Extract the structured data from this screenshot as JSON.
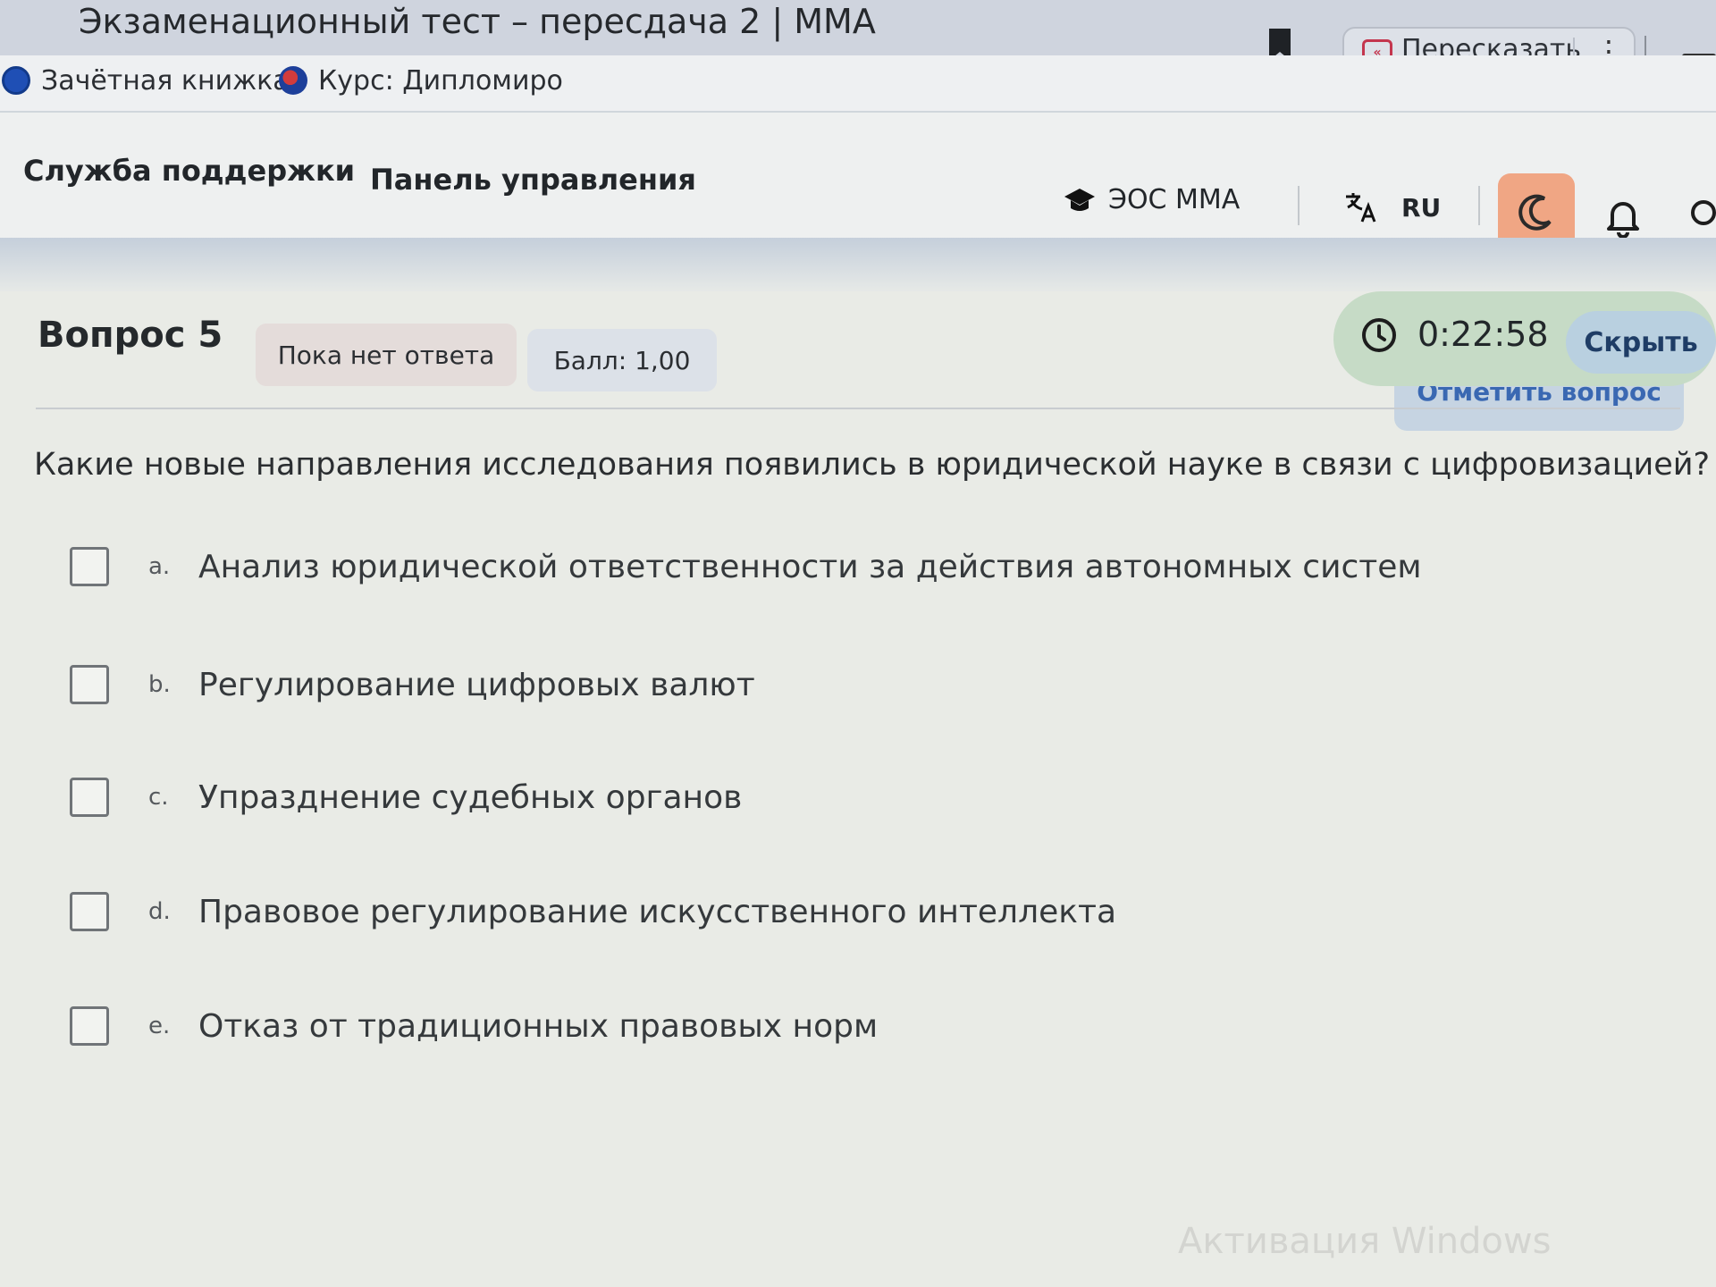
{
  "browser": {
    "tab_title": "Экзаменационный тест – пересдача 2 | ММА",
    "bookmark_icon": "bookmark-icon",
    "retell_label": "Пересказать",
    "bookmarks": [
      "Зачётная книжка",
      "Курс: Дипломиро"
    ]
  },
  "header": {
    "support": "Служба поддержки",
    "panel": "Панель управления",
    "eos": "ЭОС ММА",
    "lang": "RU",
    "accent": "#f0a684"
  },
  "question": {
    "title": "Вопрос 5",
    "status": "Пока нет ответа",
    "score": "Балл: 1,00",
    "text": "Какие новые направления исследования появились в юридической науке в связи с цифровизацией?",
    "answers": [
      {
        "letter": "a.",
        "text": "Анализ юридической ответственности за действия автономных систем",
        "checked": false
      },
      {
        "letter": "b.",
        "text": "Регулирование цифровых валют",
        "checked": false
      },
      {
        "letter": "c.",
        "text": "Упразднение судебных органов",
        "checked": false
      },
      {
        "letter": "d.",
        "text": "Правовое регулирование искусственного интеллекта",
        "checked": false
      },
      {
        "letter": "e.",
        "text": "Отказ от традиционных правовых норм",
        "checked": false
      }
    ]
  },
  "timer": {
    "value": "0:22:58",
    "hide_label": "Скрыть",
    "flag_label": "Отметить вопрос"
  },
  "watermark": "Активация Windows"
}
